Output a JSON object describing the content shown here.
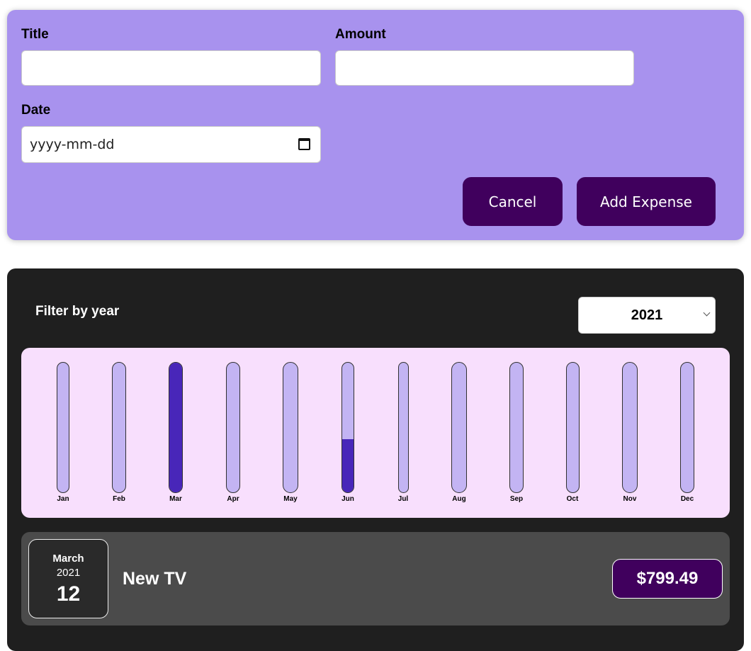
{
  "form": {
    "title_label": "Title",
    "title_value": "",
    "amount_label": "Amount",
    "amount_value": "",
    "date_label": "Date",
    "date_placeholder": "yyyy-mm-dd",
    "cancel_label": "Cancel",
    "submit_label": "Add Expense"
  },
  "filter": {
    "label": "Filter by year",
    "selected_year": "2021"
  },
  "chart_data": {
    "type": "bar",
    "categories": [
      "Jan",
      "Feb",
      "Mar",
      "Apr",
      "May",
      "Jun",
      "Jul",
      "Aug",
      "Sep",
      "Oct",
      "Nov",
      "Dec"
    ],
    "values": [
      0,
      0,
      1.0,
      0,
      0,
      0.41,
      0,
      0,
      0,
      0,
      0,
      0
    ],
    "ylim": [
      0,
      1
    ],
    "colors": {
      "track": "#c3b4f3",
      "fill": "#4826b9",
      "background": "#f8dffd"
    }
  },
  "expenses": [
    {
      "month": "March",
      "year": "2021",
      "day": "12",
      "title": "New TV",
      "amount": "$799.49"
    }
  ],
  "colors": {
    "form_bg": "#a892ee",
    "button_bg": "#40005d",
    "expenses_bg": "#1f1f1f",
    "item_bg": "#4b4b4b"
  }
}
